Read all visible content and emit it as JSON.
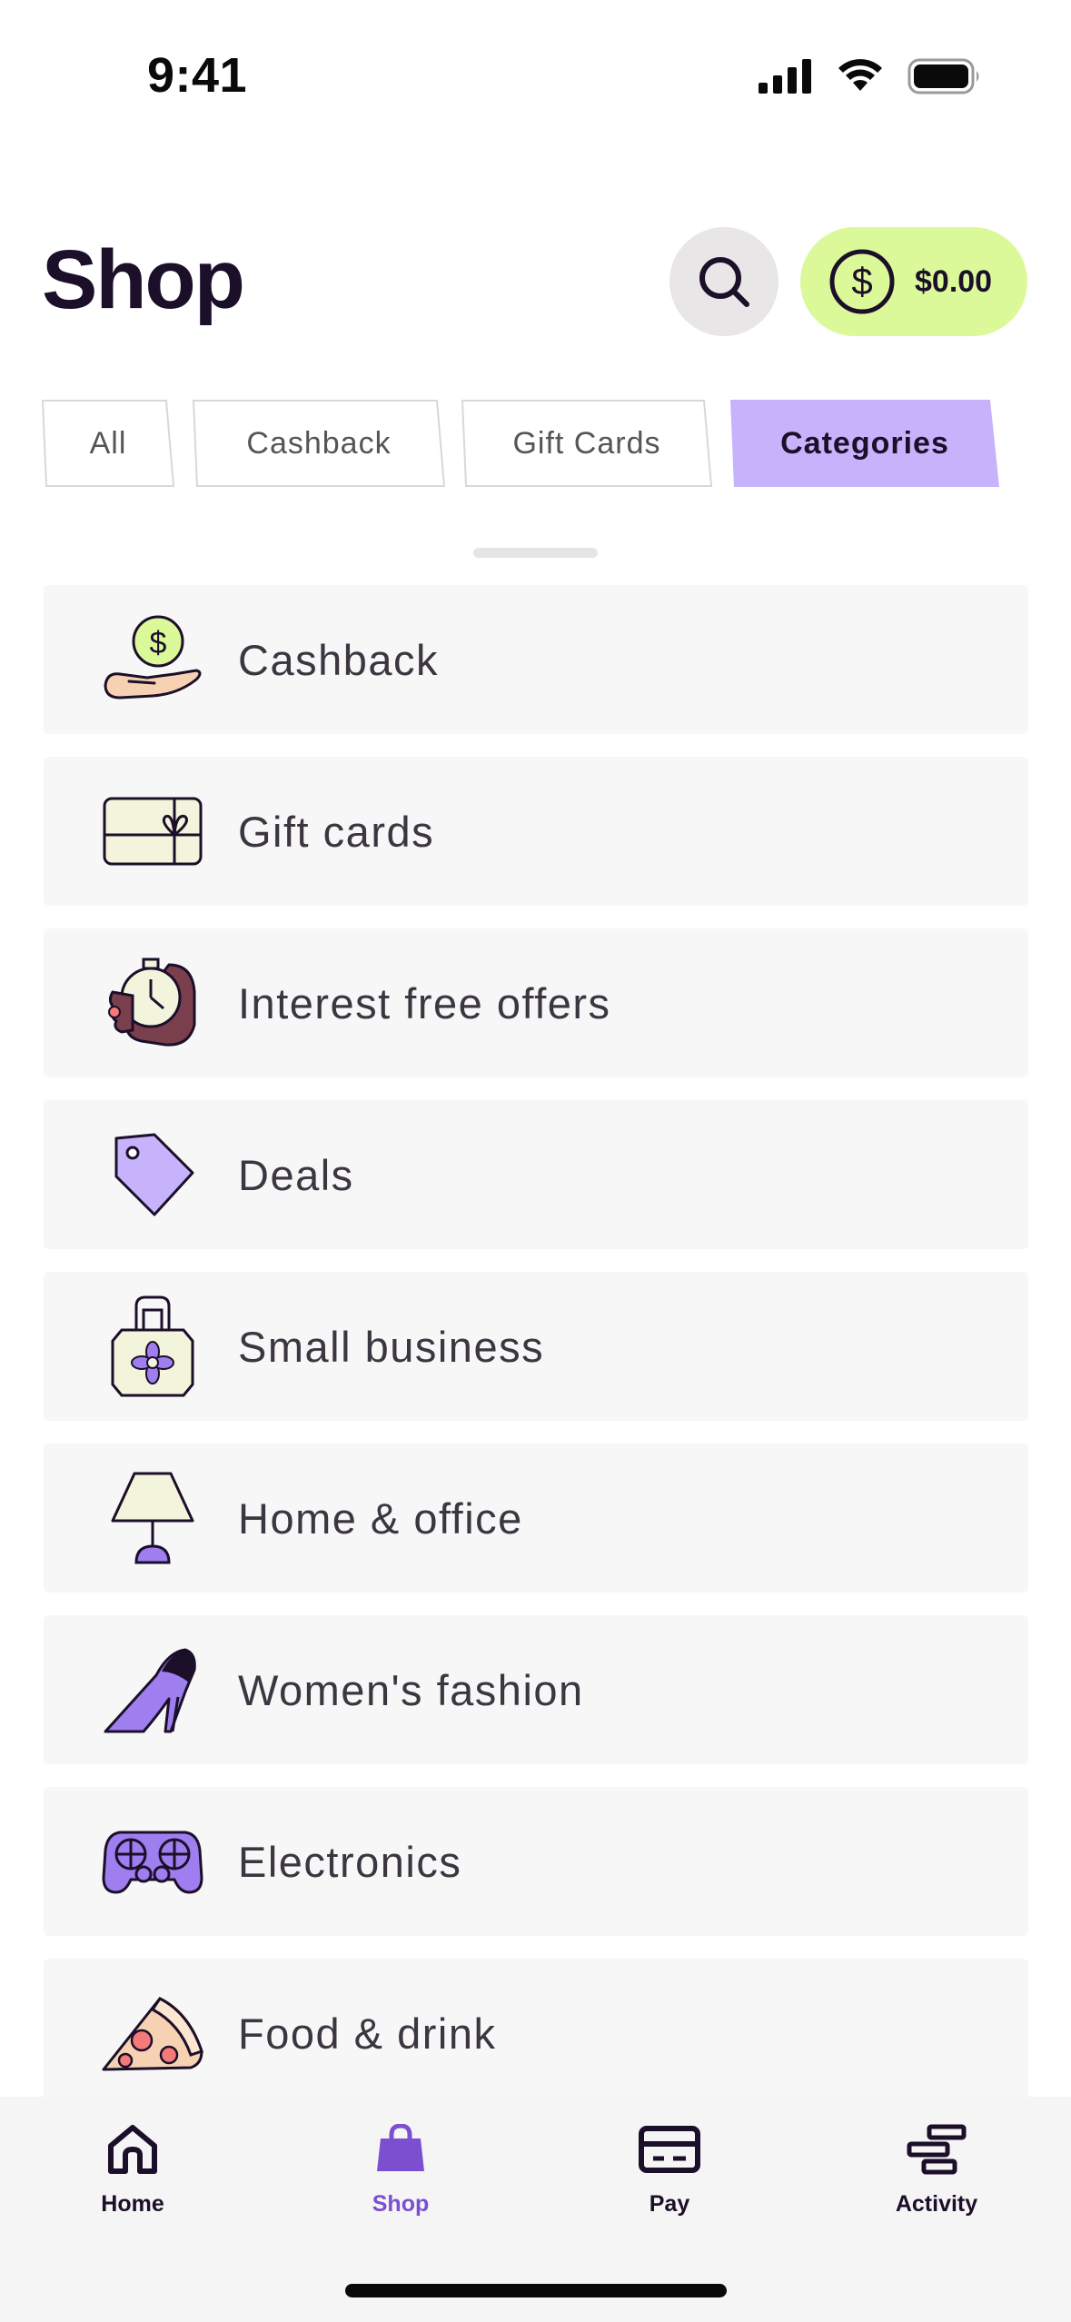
{
  "status_bar": {
    "time": "9:41"
  },
  "header": {
    "title": "Shop",
    "balance": "$0.00"
  },
  "tabs": [
    {
      "label": "All",
      "active": false
    },
    {
      "label": "Cashback",
      "active": false
    },
    {
      "label": "Gift Cards",
      "active": false
    },
    {
      "label": "Categories",
      "active": true
    }
  ],
  "categories": [
    {
      "label": "Cashback",
      "icon": "hand-coin-icon"
    },
    {
      "label": "Gift cards",
      "icon": "gift-card-icon"
    },
    {
      "label": "Interest free offers",
      "icon": "stopwatch-hand-icon"
    },
    {
      "label": "Deals",
      "icon": "price-tag-icon"
    },
    {
      "label": "Small business",
      "icon": "tote-bag-icon"
    },
    {
      "label": "Home & office",
      "icon": "lamp-icon"
    },
    {
      "label": "Women's fashion",
      "icon": "high-heel-icon"
    },
    {
      "label": "Electronics",
      "icon": "game-controller-icon"
    },
    {
      "label": "Food & drink",
      "icon": "pizza-icon"
    }
  ],
  "bottom_nav": [
    {
      "label": "Home",
      "icon": "home-icon",
      "active": false
    },
    {
      "label": "Shop",
      "icon": "shopping-bag-icon",
      "active": true
    },
    {
      "label": "Pay",
      "icon": "card-icon",
      "active": false
    },
    {
      "label": "Activity",
      "icon": "activity-icon",
      "active": false
    }
  ],
  "colors": {
    "accent_purple": "#c6b3fb",
    "active_nav": "#7b4fd0",
    "balance_green": "#dcf99a",
    "ink": "#1c0f2a"
  }
}
